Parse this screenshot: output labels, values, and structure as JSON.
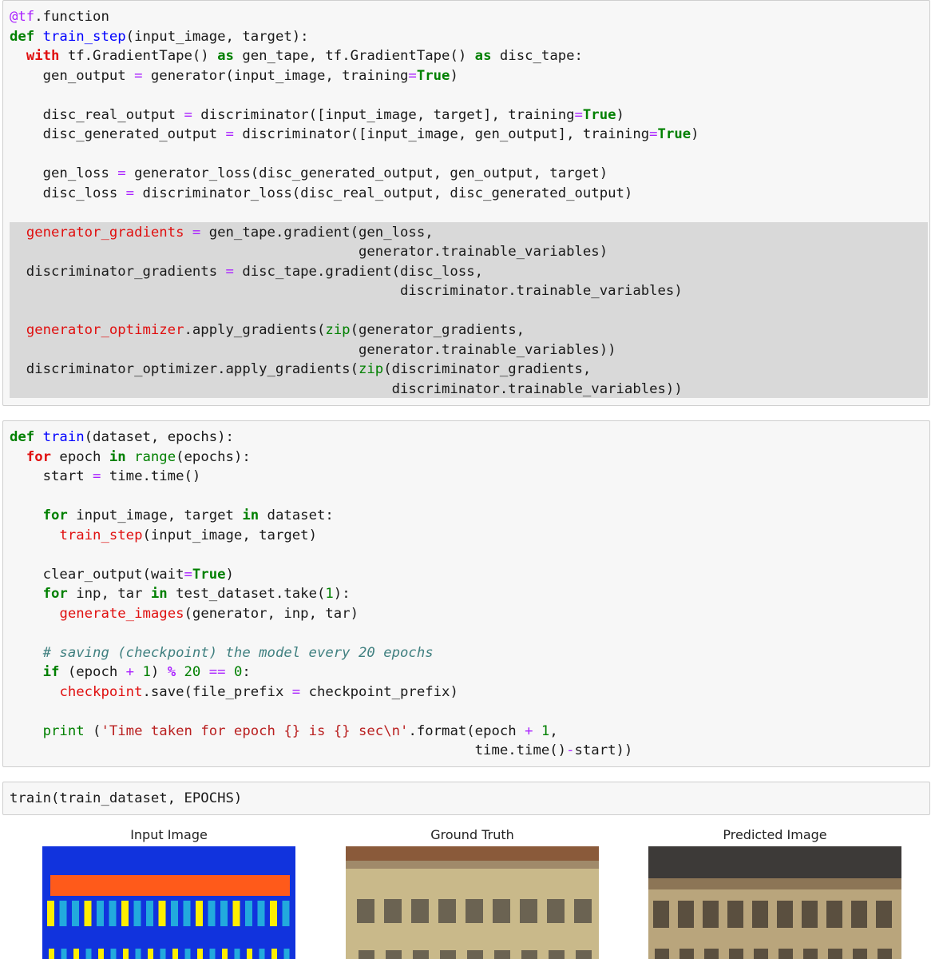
{
  "cells": [
    {
      "lines": [
        [
          {
            "t": "@tf",
            "c": "d"
          },
          {
            "t": ".function"
          }
        ],
        [
          {
            "t": "def",
            "c": "k"
          },
          {
            "t": " "
          },
          {
            "t": "train_step",
            "c": "f"
          },
          {
            "t": "(input_image, target):"
          }
        ],
        [
          {
            "t": "  "
          },
          {
            "t": "with",
            "c": "r",
            "bold": true
          },
          {
            "t": " tf.GradientTape() "
          },
          {
            "t": "as",
            "c": "k"
          },
          {
            "t": " gen_tape, tf.GradientTape() "
          },
          {
            "t": "as",
            "c": "k"
          },
          {
            "t": " disc_tape:"
          }
        ],
        [
          {
            "t": "    gen_output "
          },
          {
            "t": "=",
            "c": "op"
          },
          {
            "t": " generator(input_image, training"
          },
          {
            "t": "=",
            "c": "op"
          },
          {
            "t": "True",
            "c": "k"
          },
          {
            "t": ")"
          }
        ],
        [],
        [
          {
            "t": "    disc_real_output "
          },
          {
            "t": "=",
            "c": "op"
          },
          {
            "t": " discriminator([input_image, target], training"
          },
          {
            "t": "=",
            "c": "op"
          },
          {
            "t": "True",
            "c": "k"
          },
          {
            "t": ")"
          }
        ],
        [
          {
            "t": "    disc_generated_output "
          },
          {
            "t": "=",
            "c": "op"
          },
          {
            "t": " discriminator([input_image, gen_output], training"
          },
          {
            "t": "=",
            "c": "op"
          },
          {
            "t": "True",
            "c": "k"
          },
          {
            "t": ")"
          }
        ],
        [],
        [
          {
            "t": "    gen_loss "
          },
          {
            "t": "=",
            "c": "op"
          },
          {
            "t": " generator_loss(disc_generated_output, gen_output, target)"
          }
        ],
        [
          {
            "t": "    disc_loss "
          },
          {
            "t": "=",
            "c": "op"
          },
          {
            "t": " discriminator_loss(disc_real_output, disc_generated_output)"
          }
        ],
        [],
        [
          {
            "t": "  "
          },
          {
            "t": "generator_gradients",
            "c": "r"
          },
          {
            "t": " "
          },
          {
            "t": "=",
            "c": "op"
          },
          {
            "t": " gen_tape.gradient(gen_loss,"
          }
        ],
        [
          {
            "t": "                                          generator.trainable_variables)"
          }
        ],
        [
          {
            "t": "  discriminator_gradients "
          },
          {
            "t": "=",
            "c": "op"
          },
          {
            "t": " disc_tape.gradient(disc_loss,"
          }
        ],
        [
          {
            "t": "                                               discriminator.trainable_variables)"
          }
        ],
        [],
        [
          {
            "t": "  "
          },
          {
            "t": "generator_optimizer",
            "c": "r"
          },
          {
            "t": ".apply_gradients("
          },
          {
            "t": "zip",
            "c": "b"
          },
          {
            "t": "(generator_gradients,"
          }
        ],
        [
          {
            "t": "                                          generator.trainable_variables))"
          }
        ],
        [
          {
            "t": "  discriminator_optimizer.apply_gradients("
          },
          {
            "t": "zip",
            "c": "b"
          },
          {
            "t": "(discriminator_gradients,"
          }
        ],
        [
          {
            "t": "                                              discriminator.trainable_variables))"
          }
        ]
      ]
    },
    {
      "lines": [
        [
          {
            "t": "def",
            "c": "k"
          },
          {
            "t": " "
          },
          {
            "t": "train",
            "c": "f"
          },
          {
            "t": "(dataset, epochs):"
          }
        ],
        [
          {
            "t": "  "
          },
          {
            "t": "for",
            "c": "r",
            "bold": true
          },
          {
            "t": " epoch "
          },
          {
            "t": "in",
            "c": "k"
          },
          {
            "t": " "
          },
          {
            "t": "range",
            "c": "b"
          },
          {
            "t": "(epochs):"
          }
        ],
        [
          {
            "t": "    start "
          },
          {
            "t": "=",
            "c": "op"
          },
          {
            "t": " time.time()"
          }
        ],
        [],
        [
          {
            "t": "    "
          },
          {
            "t": "for",
            "c": "k"
          },
          {
            "t": " input_image, target "
          },
          {
            "t": "in",
            "c": "k"
          },
          {
            "t": " dataset:"
          }
        ],
        [
          {
            "t": "      "
          },
          {
            "t": "train_step",
            "c": "r"
          },
          {
            "t": "(input_image, target)"
          }
        ],
        [],
        [
          {
            "t": "    clear_output(wait"
          },
          {
            "t": "=",
            "c": "op"
          },
          {
            "t": "True",
            "c": "k"
          },
          {
            "t": ")"
          }
        ],
        [
          {
            "t": "    "
          },
          {
            "t": "for",
            "c": "k"
          },
          {
            "t": " inp, tar "
          },
          {
            "t": "in",
            "c": "k"
          },
          {
            "t": " test_dataset.take("
          },
          {
            "t": "1",
            "c": "n"
          },
          {
            "t": "):"
          }
        ],
        [
          {
            "t": "      "
          },
          {
            "t": "generate_images",
            "c": "r"
          },
          {
            "t": "(generator, inp, tar)"
          }
        ],
        [],
        [
          {
            "t": "    "
          },
          {
            "t": "# saving (checkpoint) the model every 20 epochs",
            "c": "c"
          }
        ],
        [
          {
            "t": "    "
          },
          {
            "t": "if",
            "c": "k"
          },
          {
            "t": " (epoch "
          },
          {
            "t": "+",
            "c": "op"
          },
          {
            "t": " "
          },
          {
            "t": "1",
            "c": "n"
          },
          {
            "t": ") "
          },
          {
            "t": "%",
            "c": "o"
          },
          {
            "t": " "
          },
          {
            "t": "20",
            "c": "n"
          },
          {
            "t": " "
          },
          {
            "t": "==",
            "c": "op"
          },
          {
            "t": " "
          },
          {
            "t": "0",
            "c": "n"
          },
          {
            "t": ":"
          }
        ],
        [
          {
            "t": "      "
          },
          {
            "t": "checkpoint",
            "c": "r"
          },
          {
            "t": ".save(file_prefix "
          },
          {
            "t": "=",
            "c": "op"
          },
          {
            "t": " checkpoint_prefix)"
          }
        ],
        [],
        [
          {
            "t": "    "
          },
          {
            "t": "print",
            "c": "b"
          },
          {
            "t": " ("
          },
          {
            "t": "'Time taken for epoch {} is {} sec\\n'",
            "c": "s"
          },
          {
            "t": ".format(epoch "
          },
          {
            "t": "+",
            "c": "op"
          },
          {
            "t": " "
          },
          {
            "t": "1",
            "c": "n"
          },
          {
            "t": ","
          }
        ],
        [
          {
            "t": "                                                        time.time()"
          },
          {
            "t": "-",
            "c": "op"
          },
          {
            "t": "start))"
          }
        ]
      ]
    },
    {
      "lines": [
        [
          {
            "t": "train(train_dataset, EPOCHS)"
          }
        ]
      ]
    }
  ],
  "output": {
    "titles": [
      "Input Image",
      "Ground Truth",
      "Predicted Image"
    ],
    "colors": {
      "input_bg": "#1133dd",
      "input_bar": "#ff5a1a",
      "input_window_yellow": "#ffee00",
      "input_window_cyan": "#22aadd",
      "building_wall": "#c9b98a",
      "building_roof": "#8a5a3a",
      "building_window": "#6b6352"
    }
  }
}
